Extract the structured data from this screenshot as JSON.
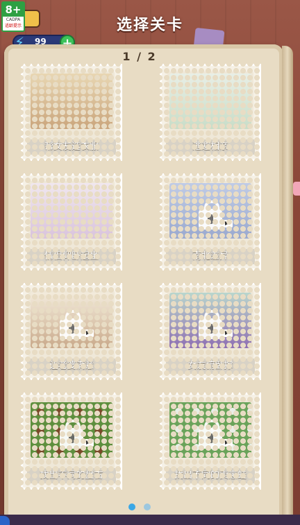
{
  "header": {
    "title": "选择关卡",
    "age_rating": {
      "number": "8+",
      "org": "CADPA",
      "tip": "适龄提示"
    },
    "energy": {
      "value": "99",
      "bolt_icon": "lightning-icon",
      "add_icon": "plus-icon"
    }
  },
  "pager": {
    "text": "1 / 2",
    "current": 1,
    "total": 2
  },
  "levels": [
    {
      "label": "帮女友选衣服",
      "locked": false,
      "theme": "#d9c7a5"
    },
    {
      "label": "逃避相亲",
      "locked": false,
      "theme": "#cfe3d2"
    },
    {
      "label": "情侣仰卧起坐",
      "locked": false,
      "theme": "#e7dcec"
    },
    {
      "label": "南北差异",
      "locked": true,
      "theme": "#c9d2e8"
    },
    {
      "label": "让老婆满意",
      "locked": true,
      "theme": "#f1e6d6"
    },
    {
      "label": "女友俯卧撑",
      "locked": true,
      "theme": "#c4d9d0"
    },
    {
      "label": "找出不同的盘古",
      "locked": true,
      "theme": "#5e8f3e"
    },
    {
      "label": "找出不同的卖崽蛙",
      "locked": true,
      "theme": "#6aa35a"
    }
  ],
  "page_dots": {
    "active_index": 0,
    "count": 2
  },
  "colors": {
    "wood": "#8b4a3c",
    "book": "#e8dcc4",
    "energy_bg": "#2b3a78",
    "dot_active": "#3aa7e6"
  }
}
